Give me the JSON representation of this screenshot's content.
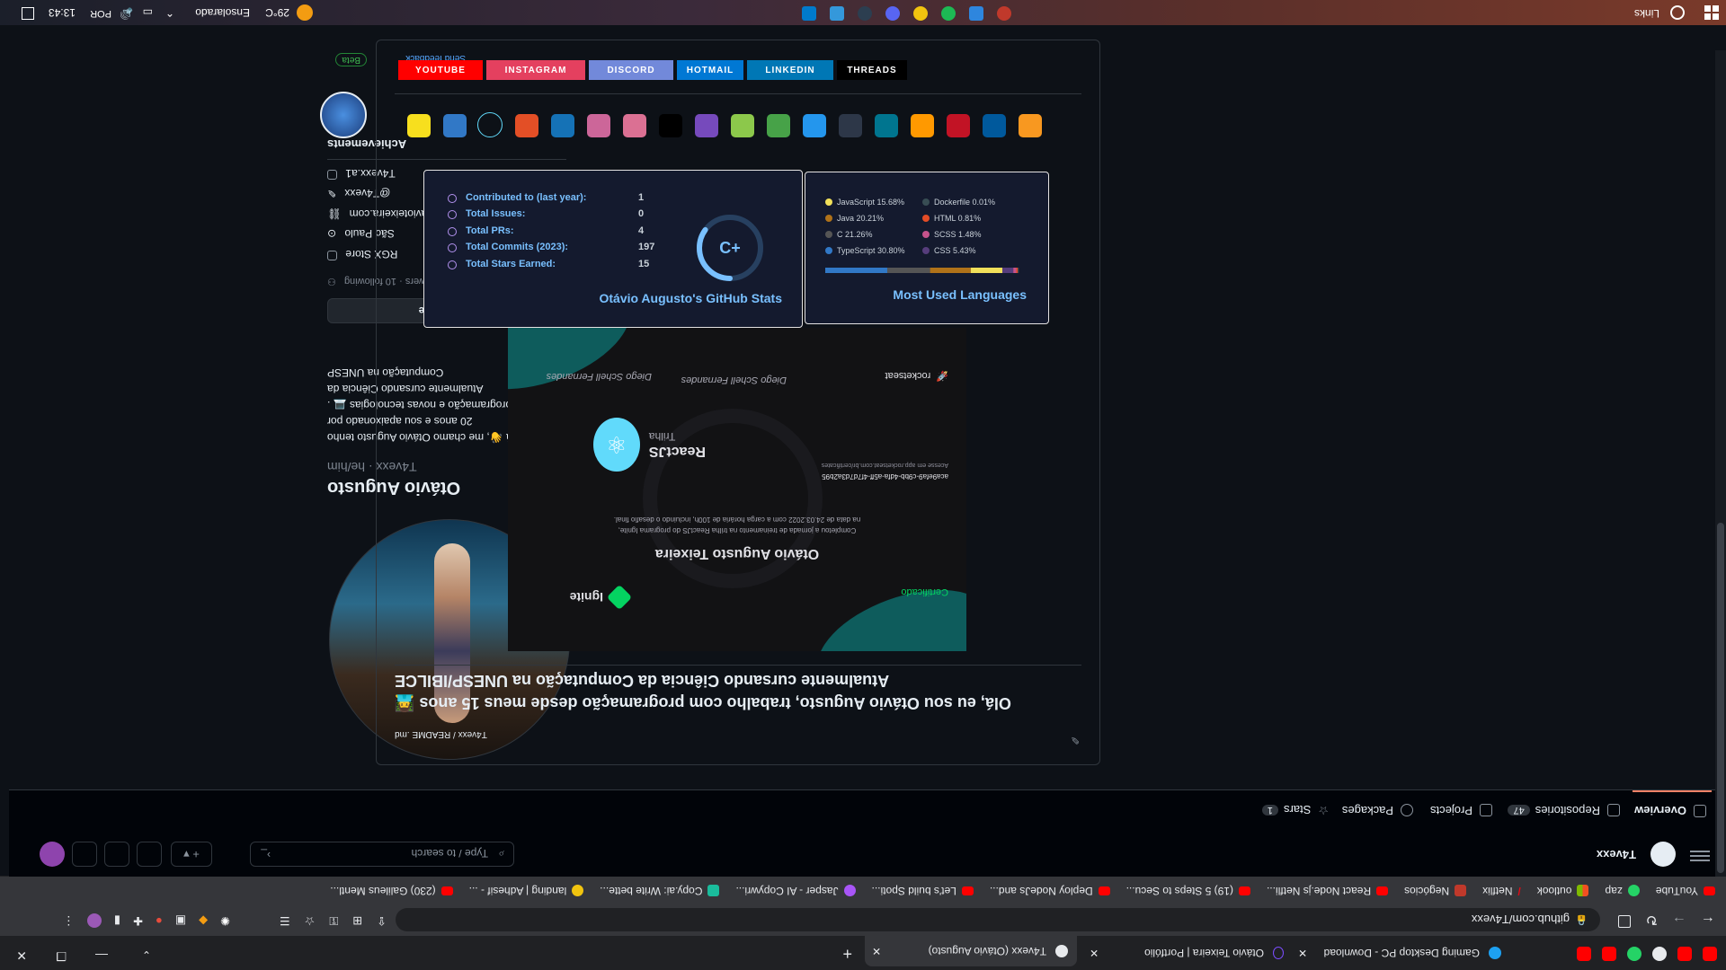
{
  "taskbar": {
    "links_label": "Links",
    "weather": "29°C",
    "weather_desc": "Ensolarado",
    "lang": "POR",
    "time": "13:43"
  },
  "browser": {
    "tabs": [
      {
        "label": "Gaming Desktop PC - Download"
      },
      {
        "label": "Otávio Teixeira | Portfólio"
      },
      {
        "label": "T4vexx (Otávio Augusto)"
      }
    ],
    "url": "github.com/T4vexx",
    "bookmarks": [
      "YouTube",
      "zap",
      "outlook",
      "Netflix",
      "Negócios",
      "React Node.js Netfli...",
      "(19) 5 Steps to Secu...",
      "Deploy NodeJs and...",
      "Let's build Spoti...",
      "Jasper - AI Copywri...",
      "Copy.ai: Write bette...",
      "landing | Adhesif - ...",
      "(230) Galileus Mentl..."
    ]
  },
  "github": {
    "username": "T4vexx",
    "search_placeholder": "Type / to search",
    "nav": {
      "overview": "Overview",
      "repositories": "Repositories",
      "repositories_count": "47",
      "projects": "Projects",
      "packages": "Packages",
      "stars": "Stars",
      "stars_count": "1"
    }
  },
  "profile": {
    "name": "Otávio Augusto",
    "handle": "T4vexx · he/him",
    "bio_lines": [
      "Olá 👋, me chamo Otávio Augusto tenho",
      "20 anos e sou apaixonado por",
      "programação e novas tecnologias 💻 .",
      "Atualmente cursando Ciência da",
      "Computação na UNESP"
    ],
    "edit_button": "Edit profile",
    "followers_text": "17 followers · 10 following",
    "details": [
      "RGX Store",
      "São Paulo",
      "https://otavioteixeira.com",
      "@T4vexx",
      "T4vexx.a1"
    ],
    "achievements_title": "Achievements",
    "beta_badge": "Beta",
    "feedback_link": "Send feedback"
  },
  "readme": {
    "path": "T4vexx / README .md",
    "intro_line1": "Olá, eu sou Otávio Augusto, trabalho com programação desde meus 15 anos 👨‍💻",
    "intro_line2": "Atualmente cursando Ciência da Computação na UNESP/IBILCE",
    "social_buttons": [
      {
        "label": "YOUTUBE",
        "color": "#ff0000"
      },
      {
        "label": "INSTAGRAM",
        "color": "#e4405f"
      },
      {
        "label": "DISCORD",
        "color": "#7289da"
      },
      {
        "label": "HOTMAIL",
        "color": "#0078d4"
      },
      {
        "label": "LINKEDIN",
        "color": "#0077b5"
      },
      {
        "label": "THREADS",
        "color": "#000000"
      }
    ],
    "tech_icons": [
      "js-icon",
      "ts-icon",
      "react-icon",
      "html5-icon",
      "css3-icon",
      "sass-icon",
      "styled-icon",
      "nextjs-icon",
      "redux-icon",
      "nodejs-icon",
      "mongodb-icon",
      "docker-icon",
      "prisma-icon",
      "mysql-icon",
      "aws-icon",
      "jest-icon",
      "c-icon",
      "java-icon"
    ]
  },
  "stats_card": {
    "title": "Otávio Augusto's GitHub Stats",
    "rows": [
      {
        "label": "Total Stars Earned:",
        "value": "15"
      },
      {
        "label": "Total Commits (2023):",
        "value": "197"
      },
      {
        "label": "Total PRs:",
        "value": "4"
      },
      {
        "label": "Total Issues:",
        "value": "0"
      },
      {
        "label": "Contributed to (last year):",
        "value": "1"
      }
    ],
    "grade": "C+",
    "grade_progress": 0.35
  },
  "langs_card": {
    "title": "Most Used Languages",
    "languages": [
      {
        "name": "TypeScript 30.80%",
        "color": "#3178c6"
      },
      {
        "name": "C 21.26%",
        "color": "#555555"
      },
      {
        "name": "Java 20.21%",
        "color": "#b07219"
      },
      {
        "name": "JavaScript 15.68%",
        "color": "#f1e05a"
      },
      {
        "name": "CSS 5.43%",
        "color": "#563d7c"
      },
      {
        "name": "SCSS 1.48%",
        "color": "#c6538c"
      },
      {
        "name": "HTML 0.81%",
        "color": "#e34c26"
      },
      {
        "name": "Dockerfile 0.01%",
        "color": "#384d54"
      }
    ],
    "bar": [
      0.308,
      0.2126,
      0.2021,
      0.1568,
      0.0543,
      0.0148,
      0.0081,
      0.0001
    ]
  },
  "certificate": {
    "brand": "Ignite",
    "label": "Certificado",
    "recipient": "Otávio Augusto Teixeira",
    "line1": "Completou a jornada de treinamento na trilha ReactJS do programa Ignite,",
    "line2": "na data de 24.03.2022 com a carga horária de 100h, incluindo o desafio final.",
    "track_label": "Trilha",
    "track_name": "ReactJS",
    "hash": "aca9efa9-c9bb-4dfa-a5ff-4f7d7d3a2b95",
    "verify_text": "Acesse em app.rocketseat.com.br/certificates",
    "company": "rocketseat",
    "sign1": "Diego Schell Fernandes",
    "sign2": "Diego Schell Fernandes"
  }
}
